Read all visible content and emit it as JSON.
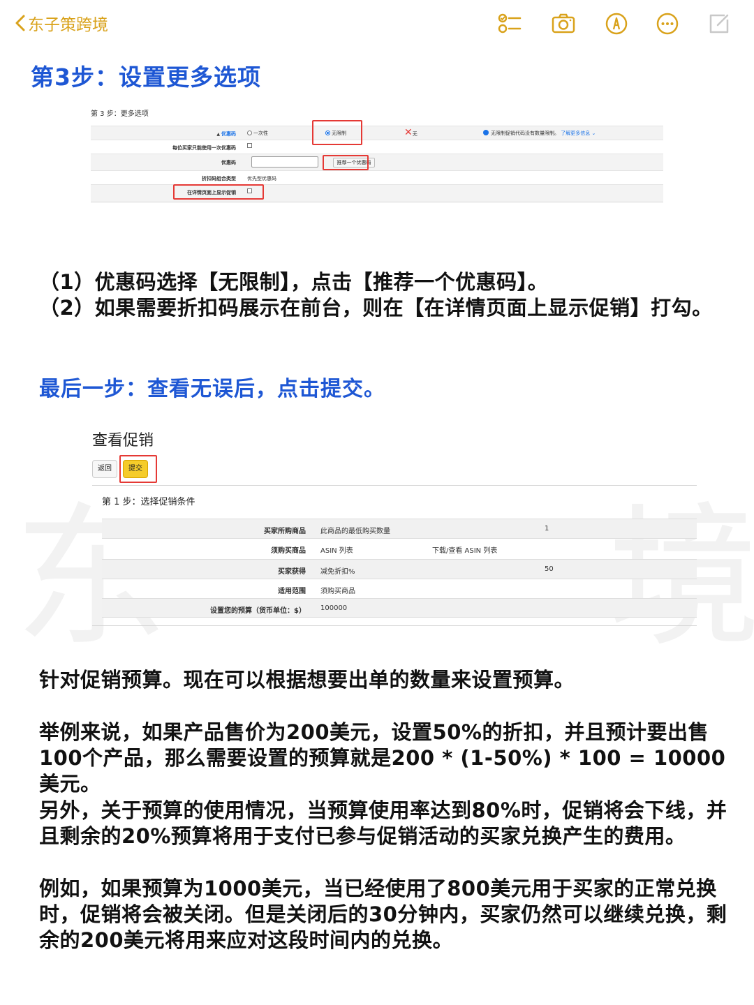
{
  "nav": {
    "back_label": "东子策跨境",
    "icons": [
      "checklist-icon",
      "camera-icon",
      "markup-pen-icon",
      "more-icon",
      "compose-icon"
    ]
  },
  "step3": {
    "heading": "第3步：设置更多选项",
    "screenshot": {
      "title": "第 3 步：更多选项",
      "rows": [
        {
          "label": "优惠码",
          "options": [
            "一次性",
            "无限制",
            "无"
          ],
          "selected": "无限制",
          "info": "无限制促销代码没有数量限制。",
          "info_link": "了解更多信息"
        },
        {
          "label": "每位买家只能使用一次优惠码"
        },
        {
          "label": "优惠码",
          "button": "推荐一个优惠码"
        },
        {
          "label": "折扣码组合类型",
          "value": "优先型优惠码"
        },
        {
          "label": "在详情页面上显示促销"
        }
      ]
    },
    "note1": "（1）优惠码选择【无限制】，点击【推荐一个优惠码】。",
    "note2": "（2）如果需要折扣码展示在前台，则在【在详情页面上显示促销】打勾。"
  },
  "final": {
    "heading": "最后一步：查看无误后，点击提交。",
    "screenshot": {
      "title": "查看促销",
      "back_button": "返回",
      "submit_button": "提交",
      "step": "第 1 步：选择促销条件",
      "rows": [
        {
          "label": "买家所购商品",
          "value": "此商品的最低购买数量",
          "extra": "1"
        },
        {
          "label": "须购买商品",
          "value": "ASIN 列表",
          "link": "下载/查看 ASIN 列表"
        },
        {
          "label": "买家获得",
          "value": "减免折扣%",
          "extra": "50"
        },
        {
          "label": "适用范围",
          "value": "须购买商品"
        },
        {
          "label": "设置您的预算（货币单位：$）",
          "value": "100000"
        }
      ]
    }
  },
  "paragraphs": {
    "p1": "针对促销预算。现在可以根据想要出单的数量来设置预算。",
    "p2": "举例来说，如果产品售价为200美元，设置50%的折扣，并且预计要出售100个产品，那么需要设置的预算就是200 * (1-50%) * 100 = 10000美元。",
    "p3": "另外，关于预算的使用情况，当预算使用率达到80%时，促销将会下线，并且剩余的20%预算将用于支付已参与促销活动的买家兑换产生的费用。",
    "p4": "例如，如果预算为1000美元，当已经使用了800美元用于买家的正常兑换时，促销将会被关闭。但是关闭后的30分钟内，买家仍然可以继续兑换，剩余的200美元将用来应对这段时间内的兑换。"
  },
  "colors": {
    "accent_yellow": "#d9a21b",
    "heading_blue": "#1e57d4",
    "highlight_red": "#e53935",
    "submit_yellow": "#f5cc2a"
  }
}
